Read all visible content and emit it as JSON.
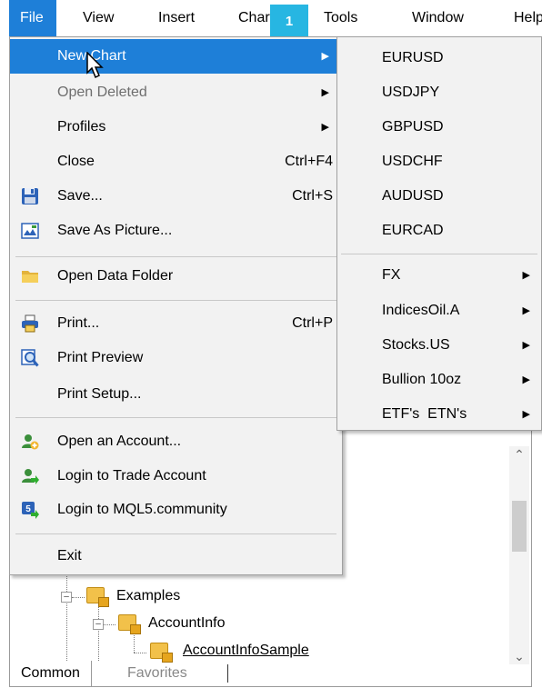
{
  "menubar": {
    "items": [
      "File",
      "View",
      "Insert",
      "Charts",
      "Tools",
      "Window",
      "Help"
    ],
    "active": "File"
  },
  "step_badge": "1",
  "file_menu": {
    "items": [
      {
        "label": "New Chart",
        "shortcut": "",
        "submenu": true,
        "highlighted": true,
        "icon": ""
      },
      {
        "label": "Open Deleted",
        "shortcut": "",
        "submenu": true,
        "disabled": true,
        "icon": ""
      },
      {
        "label": "Profiles",
        "shortcut": "",
        "submenu": true,
        "icon": ""
      },
      {
        "label": "Close",
        "shortcut": "Ctrl+F4",
        "icon": ""
      },
      {
        "label": "Save...",
        "shortcut": "Ctrl+S",
        "icon": "floppy-disk-icon"
      },
      {
        "label": "Save As Picture...",
        "shortcut": "",
        "icon": "picture-icon"
      },
      {
        "label": "Open Data Folder",
        "shortcut": "",
        "icon": "folder-icon"
      },
      {
        "label": "Print...",
        "shortcut": "Ctrl+P",
        "icon": "printer-icon"
      },
      {
        "label": "Print Preview",
        "shortcut": "",
        "icon": "magnifier-icon"
      },
      {
        "label": "Print Setup...",
        "shortcut": "",
        "icon": ""
      },
      {
        "label": "Open an Account...",
        "shortcut": "",
        "icon": "add-account-icon"
      },
      {
        "label": "Login to Trade Account",
        "shortcut": "",
        "icon": "login-account-icon"
      },
      {
        "label": "Login to MQL5.community",
        "shortcut": "",
        "icon": "mql5-login-icon"
      },
      {
        "label": "Exit",
        "shortcut": "",
        "icon": ""
      }
    ]
  },
  "new_chart_submenu": {
    "symbols": [
      "EURUSD",
      "USDJPY",
      "GBPUSD",
      "USDCHF",
      "AUDUSD",
      "EURCAD"
    ],
    "groups": [
      "FX",
      "IndicesOil.A",
      "Stocks.US",
      "Bullion 10oz",
      "ETF's  ETN's"
    ]
  },
  "navigator": {
    "tree": [
      "Examples",
      "AccountInfo",
      "AccountInfoSample"
    ],
    "tabs": [
      "Common",
      "Favorites"
    ]
  },
  "colors": {
    "highlight": "#1e7fd8",
    "badge": "#27b6e2",
    "menu_bg": "#f2f2f2"
  }
}
